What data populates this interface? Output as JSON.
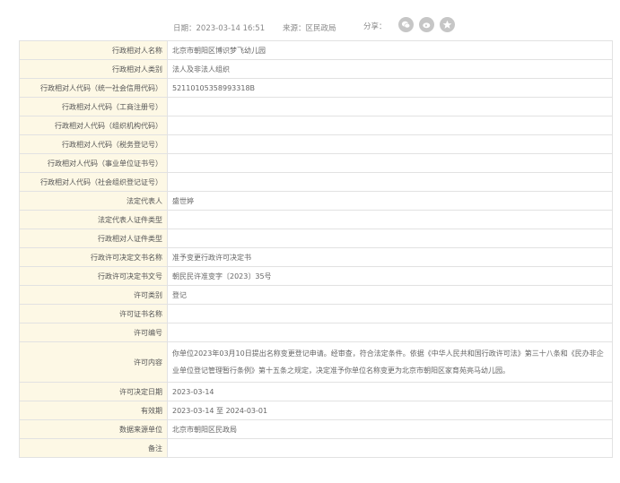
{
  "meta": {
    "date": "日期：2023-03-14 16:51",
    "source": "来源：区民政局",
    "share_label": "分享：",
    "share_icons": [
      "wechat-icon",
      "weibo-icon",
      "qzone-icon"
    ]
  },
  "rows": [
    {
      "label": "行政相对人名称",
      "value": "北京市朝阳区博识梦飞幼儿园"
    },
    {
      "label": "行政相对人类别",
      "value": "法人及非法人组织"
    },
    {
      "label": "行政相对人代码（统一社会信用代码）",
      "value": "52110105358993318B"
    },
    {
      "label": "行政相对人代码（工商注册号）",
      "value": ""
    },
    {
      "label": "行政相对人代码（组织机构代码）",
      "value": ""
    },
    {
      "label": "行政相对人代码（税务登记号）",
      "value": ""
    },
    {
      "label": "行政相对人代码（事业单位证书号）",
      "value": ""
    },
    {
      "label": "行政相对人代码（社会组织登记证号）",
      "value": ""
    },
    {
      "label": "法定代表人",
      "value": "盛世婷"
    },
    {
      "label": "法定代表人证件类型",
      "value": ""
    },
    {
      "label": "行政相对人证件类型",
      "value": ""
    },
    {
      "label": "行政许可决定文书名称",
      "value": "准予变更行政许可决定书"
    },
    {
      "label": "行政许可决定书文号",
      "value": "朝民民许准变字〔2023〕35号"
    },
    {
      "label": "许可类别",
      "value": "登记"
    },
    {
      "label": "许可证书名称",
      "value": ""
    },
    {
      "label": "许可编号",
      "value": ""
    },
    {
      "label": "许可内容",
      "value": "你单位2023年03月10日提出名称变更登记申请。经审查，符合法定条件。依据《中华人民共和国行政许可法》第三十八条和《民办非企业单位登记管理暂行条例》第十五条之规定，决定准予你单位名称变更为北京市朝阳区家育苑亮马幼儿园。"
    },
    {
      "label": "许可决定日期",
      "value": "2023-03-14"
    },
    {
      "label": "有效期",
      "value": "2023-03-14 至 2024-03-01"
    },
    {
      "label": "数据来源单位",
      "value": "北京市朝阳区民政局"
    },
    {
      "label": "备注",
      "value": ""
    }
  ]
}
